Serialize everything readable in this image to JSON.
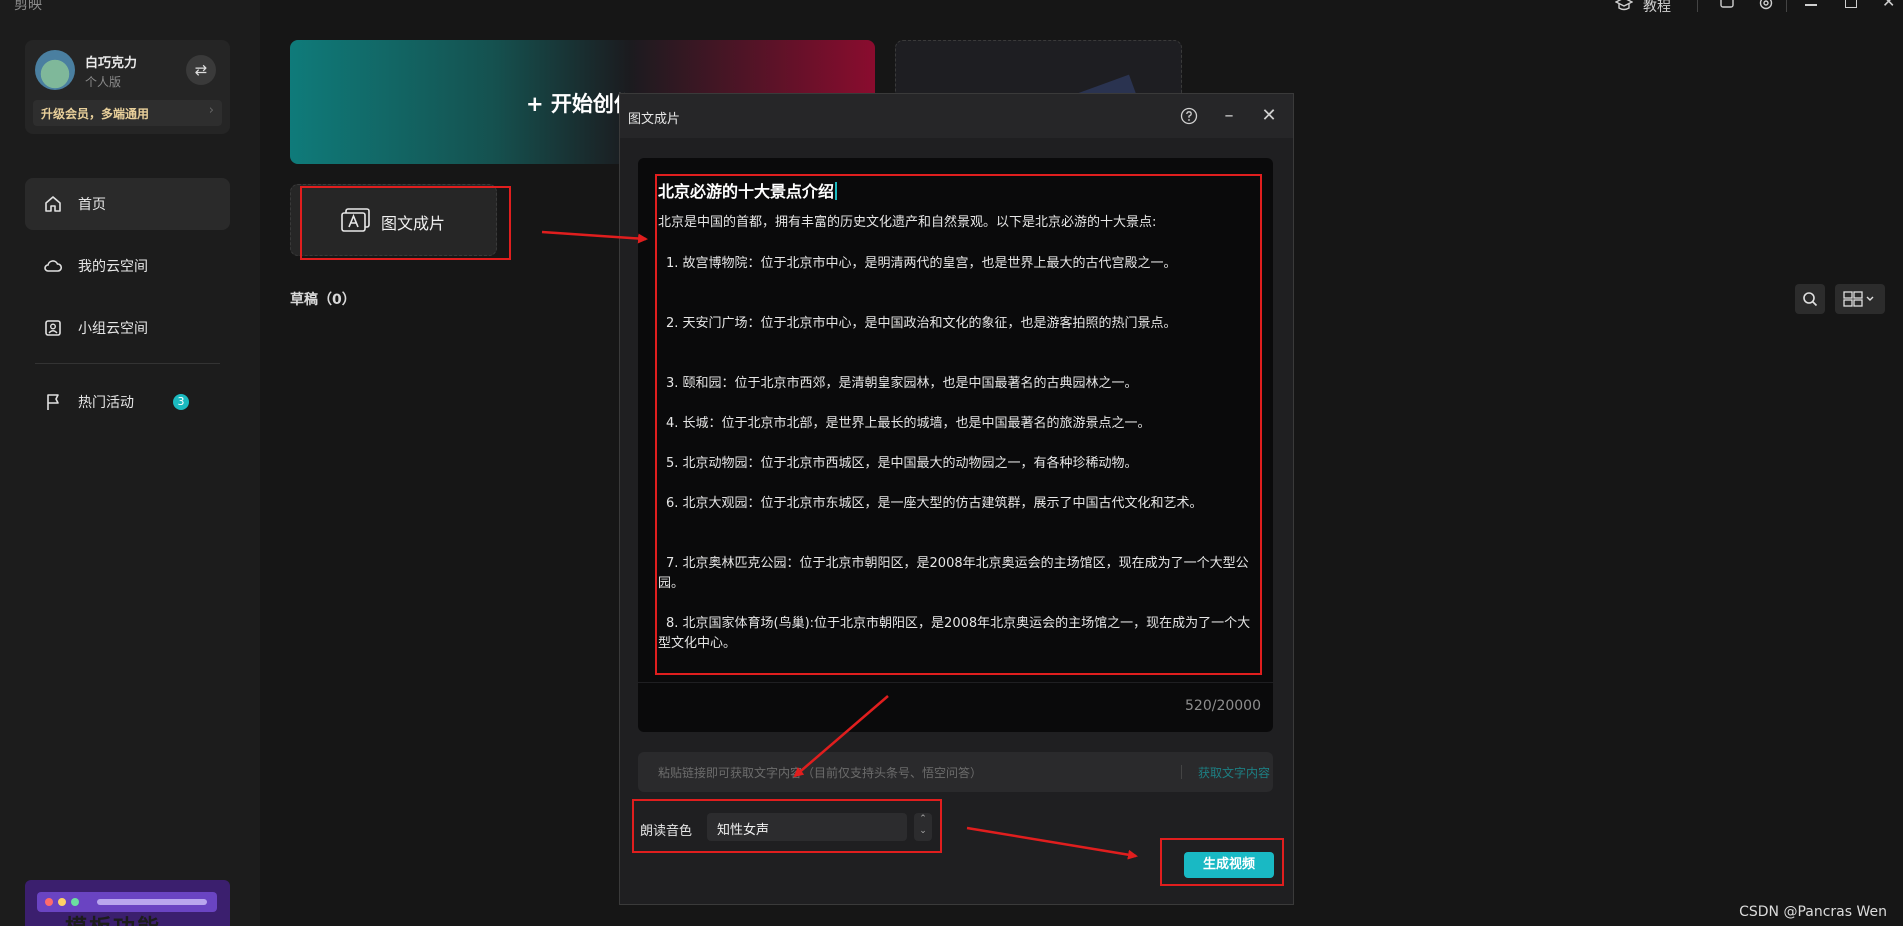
{
  "app": {
    "logo_text": "剪映"
  },
  "user": {
    "name": "白巧克力",
    "plan": "个人版",
    "upgrade_text": "升级会员，多端通用"
  },
  "sidebar": {
    "items": [
      {
        "label": "首页",
        "icon": "home-icon",
        "active": true
      },
      {
        "label": "我的云空间",
        "icon": "cloud-icon",
        "active": false
      },
      {
        "label": "小组云空间",
        "icon": "group-cloud-icon",
        "active": false
      },
      {
        "label": "热门活动",
        "icon": "flag-icon",
        "badge": "3",
        "active": false
      }
    ],
    "promo_text": "模板功能"
  },
  "topbar": {
    "tutorial_label": "教程"
  },
  "main": {
    "create_label": "+ 开始创作",
    "tuwen_label": "图文成片",
    "drafts_label": "草稿（0）"
  },
  "dialog": {
    "title": "图文成片",
    "doc_title": "北京必游的十大景点介绍",
    "intro": "北京是中国的首都，拥有丰富的历史文化遗产和自然景观。以下是北京必游的十大景点:",
    "items": [
      "1. 故宫博物院：位于北京市中心，是明清两代的皇宫，也是世界上最大的古代宫殿之一。",
      "2. 天安门广场：位于北京市中心，是中国政治和文化的象征，也是游客拍照的热门景点。",
      "3. 颐和园：位于北京市西郊，是清朝皇家园林，也是中国最著名的古典园林之一。",
      "4. 长城：位于北京市北部，是世界上最长的城墙，也是中国最著名的旅游景点之一。",
      "5. 北京动物园：位于北京市西城区，是中国最大的动物园之一，有各种珍稀动物。",
      "6. 北京大观园：位于北京市东城区，是一座大型的仿古建筑群，展示了中国古代文化和艺术。",
      "7. 北京奥林匹克公园：位于北京市朝阳区，是2008年北京奥运会的主场馆区，现在成为了一个大型公园。",
      "8. 北京国家体育场(鸟巢):位于北京市朝阳区，是2008年北京奥运会的主场馆之一，现在成为了一个大型文化中心。"
    ],
    "char_count": "520/20000",
    "link_placeholder": "粘贴链接即可获取文字内容（目前仅支持头条号、悟空问答）",
    "link_button": "获取文字内容",
    "voice_label": "朗读音色",
    "voice_value": "知性女声",
    "generate_button": "生成视频"
  },
  "watermark": "CSDN @Pancras Wen",
  "colors": {
    "accent": "#19b9c4",
    "annotation": "#e01e1e",
    "background": "#161616"
  }
}
